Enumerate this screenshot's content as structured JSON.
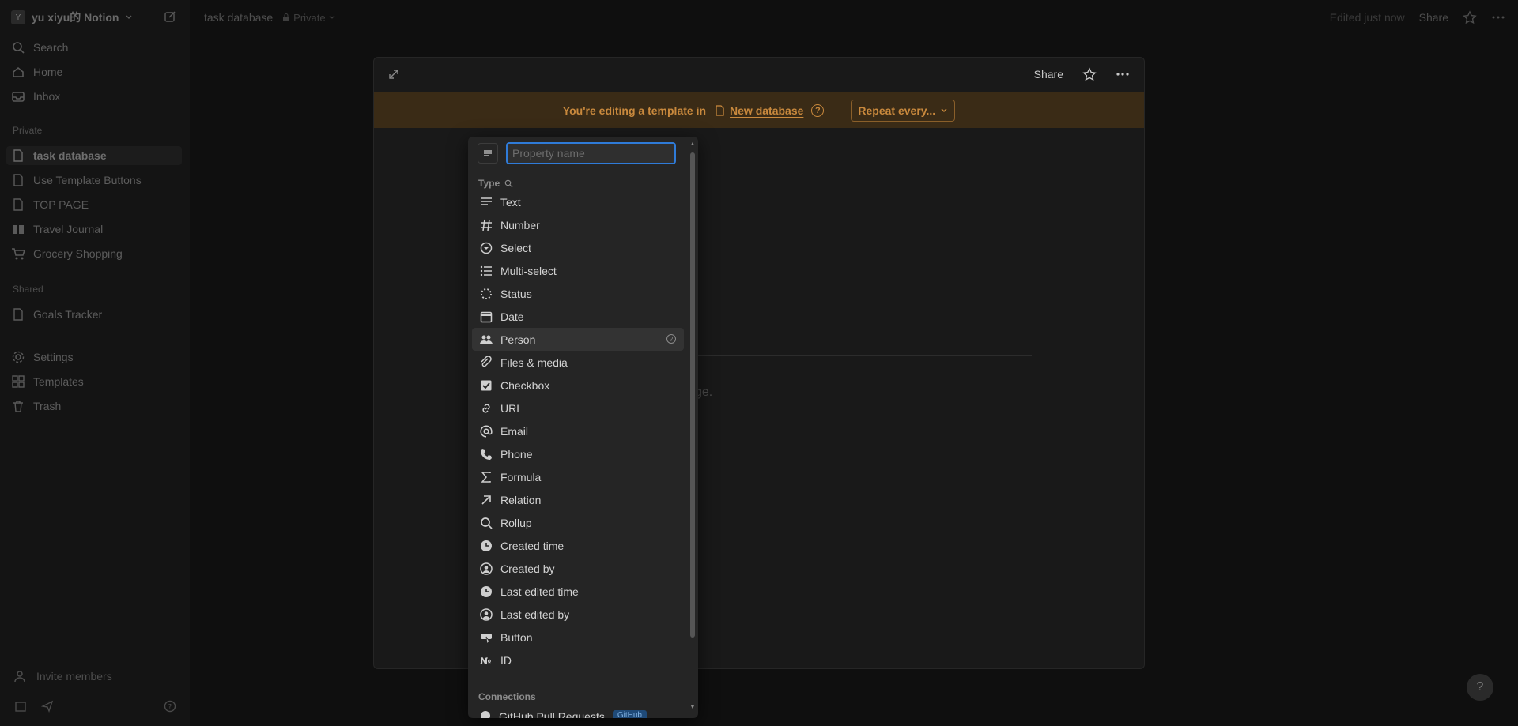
{
  "sidebar": {
    "workspace_initial": "Y",
    "workspace_name": "yu xiyu的 Notion",
    "nav": [
      {
        "label": "Search",
        "icon": "search-icon"
      },
      {
        "label": "Home",
        "icon": "home-icon"
      },
      {
        "label": "Inbox",
        "icon": "inbox-icon"
      }
    ],
    "private_label": "Private",
    "private_pages": [
      {
        "label": "task database",
        "icon": "page-icon",
        "active": true
      },
      {
        "label": "Use Template Buttons",
        "icon": "page-icon"
      },
      {
        "label": "TOP PAGE",
        "icon": "page-icon"
      },
      {
        "label": "Travel Journal",
        "icon": "book-icon"
      },
      {
        "label": "Grocery Shopping",
        "icon": "cart-icon"
      }
    ],
    "shared_label": "Shared",
    "shared_pages": [
      {
        "label": "Goals Tracker",
        "icon": "page-icon"
      }
    ],
    "bottom_nav": [
      {
        "label": "Settings",
        "icon": "gear-icon"
      },
      {
        "label": "Templates",
        "icon": "templates-icon"
      },
      {
        "label": "Trash",
        "icon": "trash-icon"
      }
    ],
    "invite_label": "Invite members"
  },
  "topbar": {
    "crumb": "task database",
    "privacy": "Private",
    "edited": "Edited just now",
    "share": "Share"
  },
  "modal": {
    "share": "Share",
    "banner_prefix": "You're editing a template in",
    "banner_db": "New database",
    "repeat_label": "Repeat every...",
    "ghost_text": "ge."
  },
  "dropdown": {
    "placeholder": "Property name",
    "type_label": "Type",
    "types": [
      {
        "label": "Text",
        "icon": "text-lines-icon"
      },
      {
        "label": "Number",
        "icon": "hash-icon"
      },
      {
        "label": "Select",
        "icon": "select-circle-icon"
      },
      {
        "label": "Multi-select",
        "icon": "list-icon"
      },
      {
        "label": "Status",
        "icon": "status-dotted-icon"
      },
      {
        "label": "Date",
        "icon": "calendar-icon"
      },
      {
        "label": "Person",
        "icon": "people-icon",
        "hover": true
      },
      {
        "label": "Files & media",
        "icon": "paperclip-icon"
      },
      {
        "label": "Checkbox",
        "icon": "checkbox-icon"
      },
      {
        "label": "URL",
        "icon": "link-icon"
      },
      {
        "label": "Email",
        "icon": "at-icon"
      },
      {
        "label": "Phone",
        "icon": "phone-icon"
      },
      {
        "label": "Formula",
        "icon": "sigma-icon"
      },
      {
        "label": "Relation",
        "icon": "arrow-up-right-icon"
      },
      {
        "label": "Rollup",
        "icon": "magnifier-icon"
      },
      {
        "label": "Created time",
        "icon": "clock-icon"
      },
      {
        "label": "Created by",
        "icon": "user-circle-icon"
      },
      {
        "label": "Last edited time",
        "icon": "clock-icon"
      },
      {
        "label": "Last edited by",
        "icon": "user-circle-icon"
      },
      {
        "label": "Button",
        "icon": "cursor-button-icon"
      },
      {
        "label": "ID",
        "icon": "numero-icon"
      }
    ],
    "connections_label": "Connections",
    "connection_item": "GitHub Pull Requests",
    "connection_badge": "GitHub"
  }
}
